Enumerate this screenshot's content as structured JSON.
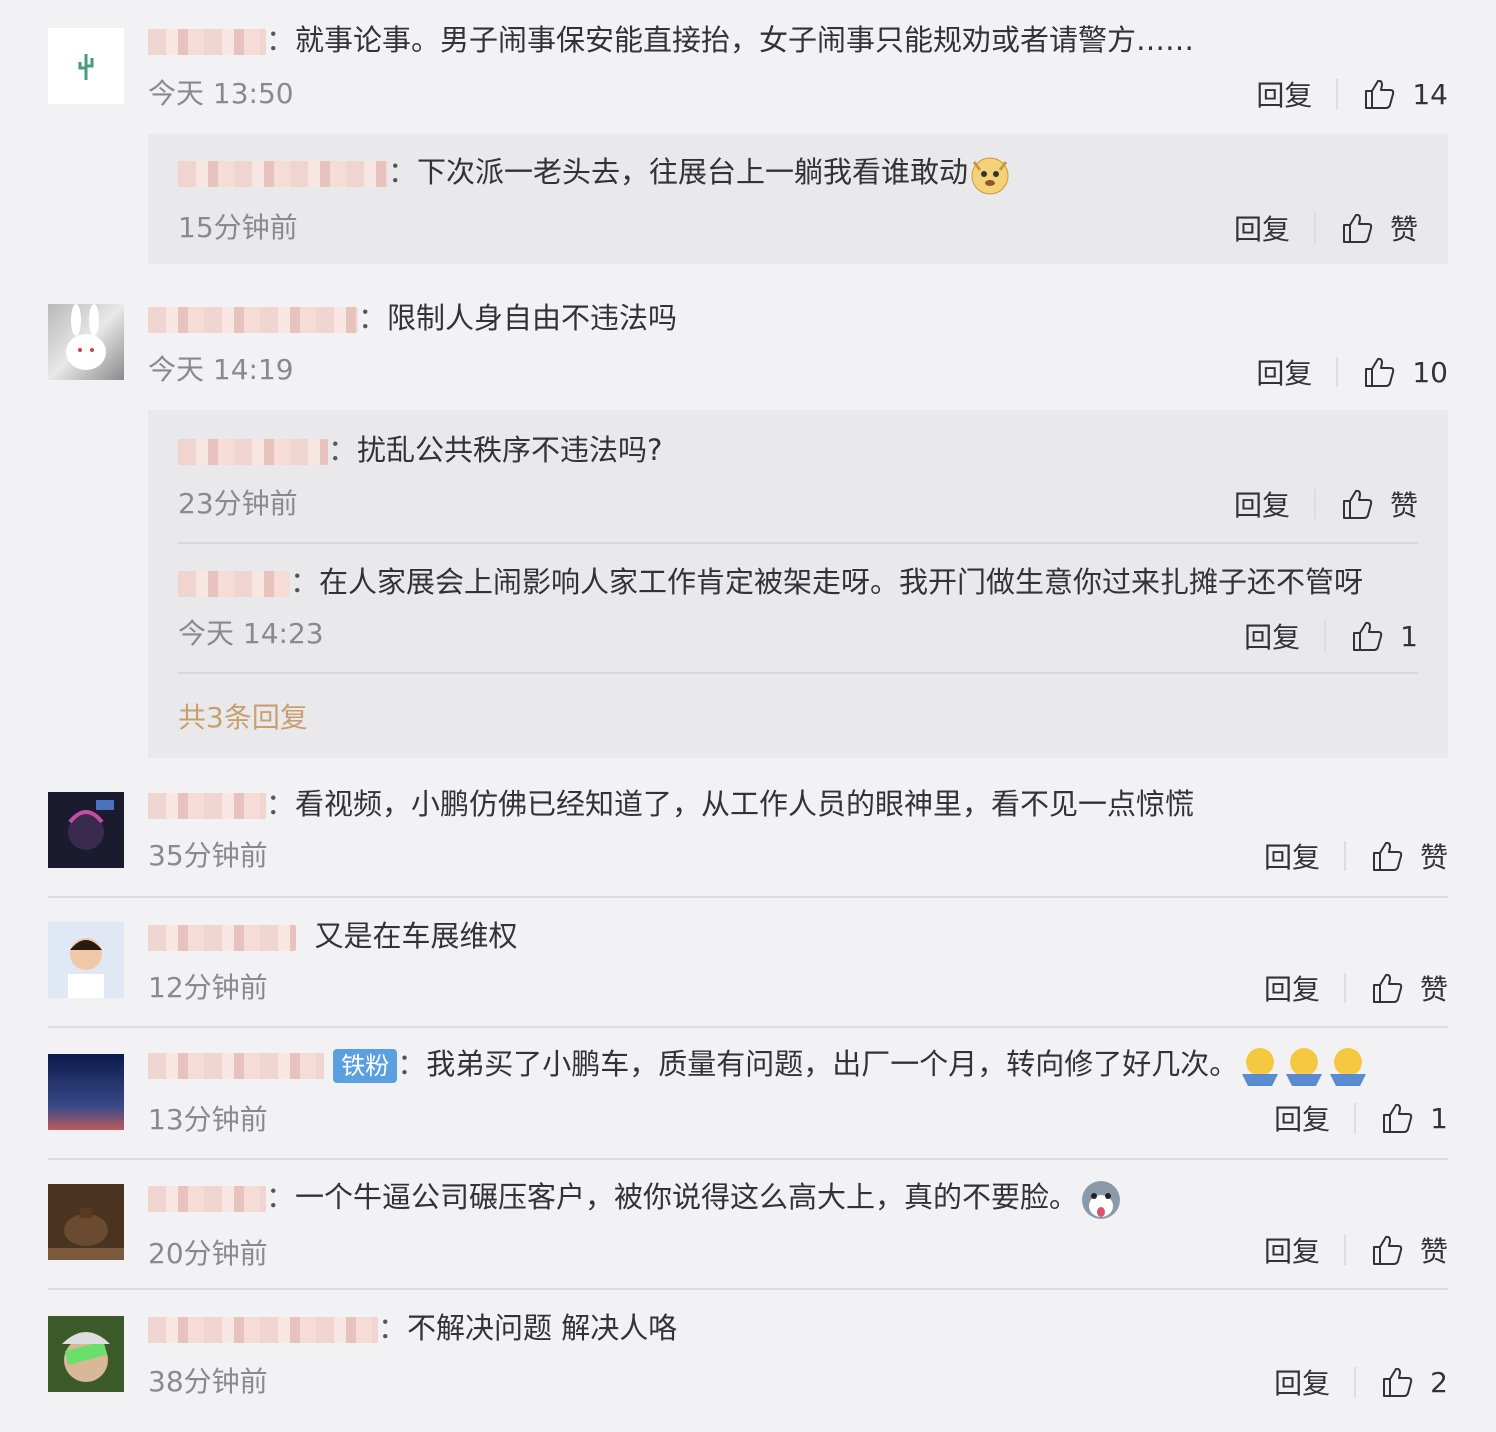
{
  "labels": {
    "reply": "回复",
    "like_zero": "赞"
  },
  "comments": [
    {
      "text": "就事论事。男子闹事保安能直接抬，女子闹事只能规劝或者请警方……",
      "time": "今天 13:50",
      "likes": "14",
      "replies": [
        {
          "text": "下次派一老头去，往展台上一躺我看谁敢动",
          "time": "15分钟前",
          "likes": "赞"
        }
      ]
    },
    {
      "text": "限制人身自由不违法吗",
      "time": "今天 14:19",
      "likes": "10",
      "replies": [
        {
          "text": "扰乱公共秩序不违法吗?",
          "time": "23分钟前",
          "likes": "赞"
        },
        {
          "text": "在人家展会上闹影响人家工作肯定被架走呀。我开门做生意你过来扎摊子还不管呀",
          "time": "今天 14:23",
          "likes": "1"
        }
      ],
      "more": "共3条回复"
    },
    {
      "text": "看视频，小鹏仿佛已经知道了，从工作人员的眼神里，看不见一点惊慌",
      "time": "35分钟前",
      "likes": "赞"
    },
    {
      "text": "又是在车展维权",
      "time": "12分钟前",
      "likes": "赞"
    },
    {
      "badge": "铁粉",
      "text": "我弟买了小鹏车，质量有问题，出厂一个月，转向修了好几次。",
      "time": "13分钟前",
      "likes": "1"
    },
    {
      "text": "一个牛逼公司碾压客户，被你说得这么高大上，真的不要脸。",
      "time": "20分钟前",
      "likes": "赞"
    },
    {
      "text": "不解决问题 解决人咯",
      "time": "38分钟前",
      "likes": "2"
    }
  ]
}
